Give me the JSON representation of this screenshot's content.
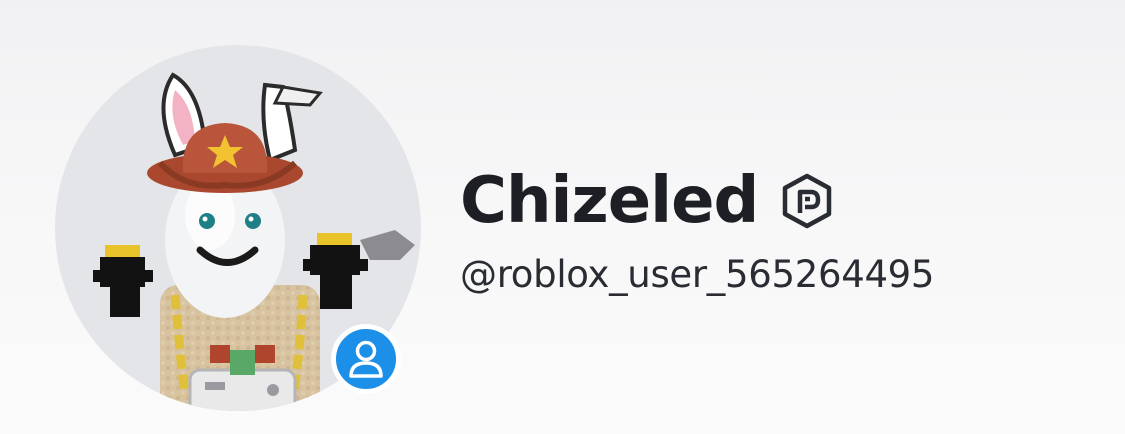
{
  "profile": {
    "display_name": "Chizeled",
    "username": "@roblox_user_565264495",
    "badge_icon": "premium-shield-icon",
    "presence_icon": "user-presence-icon",
    "colors": {
      "name_text": "#1e1f24",
      "username_text": "#2a2c33",
      "presence_badge": "#1c8fe8",
      "avatar_background": "#e3e5e8",
      "background": "#f5f5f6"
    }
  }
}
